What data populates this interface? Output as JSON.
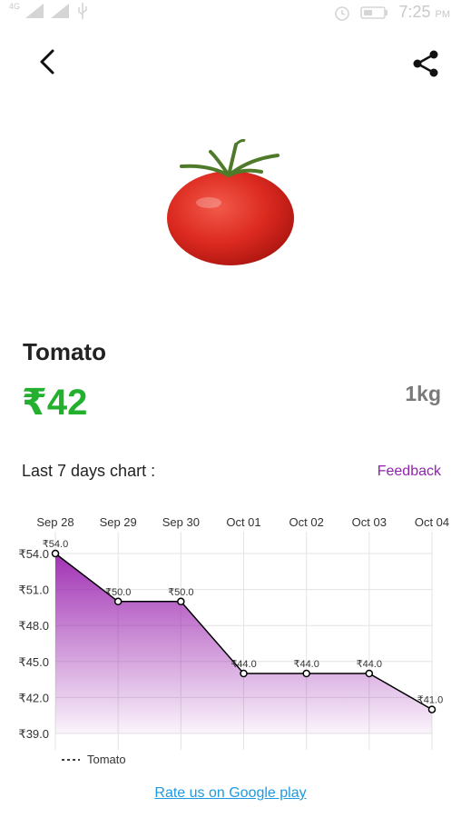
{
  "status_bar": {
    "network": "4G",
    "time": "7:25",
    "ampm": "PM"
  },
  "product": {
    "name": "Tomato",
    "price": "₹42",
    "unit": "1kg"
  },
  "chart_section": {
    "heading": "Last 7 days chart :",
    "feedback_label": "Feedback"
  },
  "footer": {
    "rate_label": "Rate us on Google play"
  },
  "colors": {
    "price_green": "#22b02e",
    "accent_purple": "#8e24aa",
    "link_blue": "#1e9be0"
  },
  "chart_data": {
    "type": "area",
    "categories": [
      "Sep 28",
      "Sep 29",
      "Sep 30",
      "Oct 01",
      "Oct 02",
      "Oct 03",
      "Oct 04"
    ],
    "series": [
      {
        "name": "Tomato",
        "values": [
          54.0,
          50.0,
          50.0,
          44.0,
          44.0,
          44.0,
          41.0
        ]
      }
    ],
    "data_labels": [
      "₹54.0",
      "₹50.0",
      "₹50.0",
      "₹44.0",
      "₹44.0",
      "₹44.0",
      "₹41.0"
    ],
    "yticks": [
      "₹54.0",
      "₹51.0",
      "₹48.0",
      "₹45.0",
      "₹42.0",
      "₹39.0"
    ],
    "ytick_values": [
      54,
      51,
      48,
      45,
      42,
      39
    ],
    "ylim": [
      39,
      54
    ],
    "grid": true,
    "legend": "bottom-left",
    "fill_color": "#9c27b0",
    "line_color": "#000000"
  }
}
